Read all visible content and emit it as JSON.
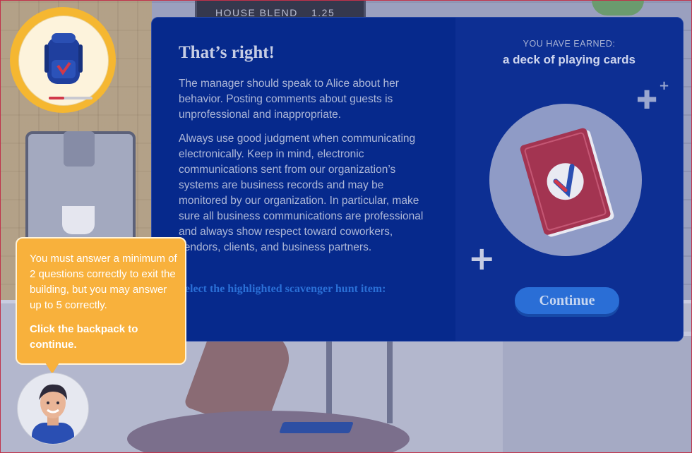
{
  "background": {
    "menu_board": {
      "item": "HOUSE BLEND",
      "price": "1.25"
    }
  },
  "backpack": {
    "icon": "backpack-icon",
    "progress": 0.35
  },
  "modal": {
    "title": "That’s right!",
    "paragraphs": [
      "The manager should speak to Alice about her behavior. Posting comments about guests is unprofessional and inappropriate.",
      "Always use good judgment when communicating electronically. Keep in mind, electronic communications sent from our organization’s systems are business records and may be monitored by our organization. In particular, make sure all business communications are professional and always show respect toward coworkers, vendors, clients, and business partners."
    ],
    "instruction": "Select the highlighted scavenger hunt item:",
    "earned_label": "YOU HAVE EARNED:",
    "reward_name": "a deck of playing cards",
    "reward_icon": "playing-cards-icon",
    "continue_label": "Continue"
  },
  "tooltip": {
    "line1": "You must answer a minimum of 2 questions correctly to exit the building, but you may answer up to 5 correctly.",
    "line2": "Click the backpack to continue."
  },
  "colors": {
    "modal_bg": "#06298c",
    "accent_button": "#2a6ed6",
    "tooltip_bg": "#f8b13c",
    "badge_ring": "#f5b731"
  }
}
